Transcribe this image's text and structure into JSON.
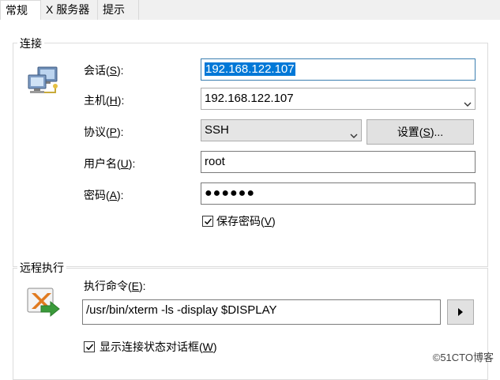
{
  "tabs": [
    {
      "label": "常规"
    },
    {
      "label": "X 服务器"
    },
    {
      "label": "提示"
    }
  ],
  "connection": {
    "title": "连接",
    "session_label": "会话(",
    "session_key": "S",
    "session_suffix": "):",
    "session_value": "192.168.122.107",
    "host_label": "主机(",
    "host_key": "H",
    "host_suffix": "):",
    "host_value": "192.168.122.107",
    "protocol_label": "协议(",
    "protocol_key": "P",
    "protocol_suffix": "):",
    "protocol_value": "SSH",
    "settings_label": "设置(",
    "settings_key": "S",
    "settings_suffix": ")...",
    "username_label": "用户名(",
    "username_key": "U",
    "username_suffix": "):",
    "username_value": "root",
    "password_label": "密码(",
    "password_key": "A",
    "password_suffix": "):",
    "password_value": "●●●●●●",
    "save_password_label": "保存密码(",
    "save_password_key": "V",
    "save_password_suffix": ")",
    "save_password_checked": true
  },
  "remote": {
    "title": "远程执行",
    "command_label": "执行命令(",
    "command_key": "E",
    "command_suffix": "):",
    "command_value": "/usr/bin/xterm -ls -display $DISPLAY",
    "show_dialog_label": "显示连接状态对话框(",
    "show_dialog_key": "W",
    "show_dialog_suffix": ")",
    "show_dialog_checked": true
  },
  "watermark": "©51CTO博客",
  "colors": {
    "accent": "#0078d7",
    "border": "#dcdcdc"
  }
}
